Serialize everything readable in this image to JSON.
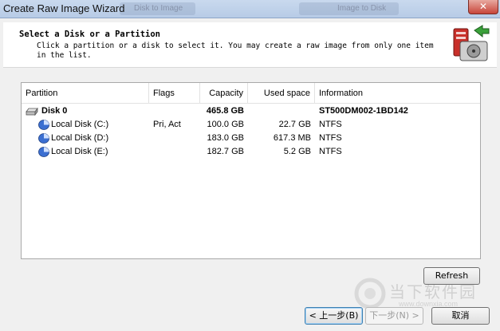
{
  "window": {
    "title": "Create Raw Image Wizard",
    "close_label": "✕",
    "background_tabs": [
      "Disk to Image",
      "Image to Disk"
    ]
  },
  "header": {
    "title": "Select a Disk or a Partition",
    "description": "Click a partition or a disk to select it. You may create a raw image from only one item in the list."
  },
  "table": {
    "columns": [
      "Partition",
      "Flags",
      "Capacity",
      "Used space",
      "Information"
    ],
    "rows": [
      {
        "partition": "Disk 0",
        "flags": "",
        "capacity": "465.8 GB",
        "used": "",
        "info": "ST500DM002-1BD142",
        "type": "disk"
      },
      {
        "partition": "Local Disk (C:)",
        "flags": "Pri, Act",
        "capacity": "100.0 GB",
        "used": "22.7 GB",
        "info": "NTFS",
        "type": "partition"
      },
      {
        "partition": "Local Disk (D:)",
        "flags": "",
        "capacity": "183.0 GB",
        "used": "617.3 MB",
        "info": "NTFS",
        "type": "partition"
      },
      {
        "partition": "Local Disk (E:)",
        "flags": "",
        "capacity": "182.7 GB",
        "used": "5.2 GB",
        "info": "NTFS",
        "type": "partition"
      }
    ]
  },
  "buttons": {
    "refresh": "Refresh",
    "back": "< 上一步(B)",
    "next": "下一步(N) >",
    "cancel": "取消"
  },
  "watermark": {
    "text": "当下软件园",
    "url": "www.downxia.com"
  },
  "colors": {
    "titlebar": "#c9d9ee",
    "partition_icon": "#3b6fd1"
  }
}
